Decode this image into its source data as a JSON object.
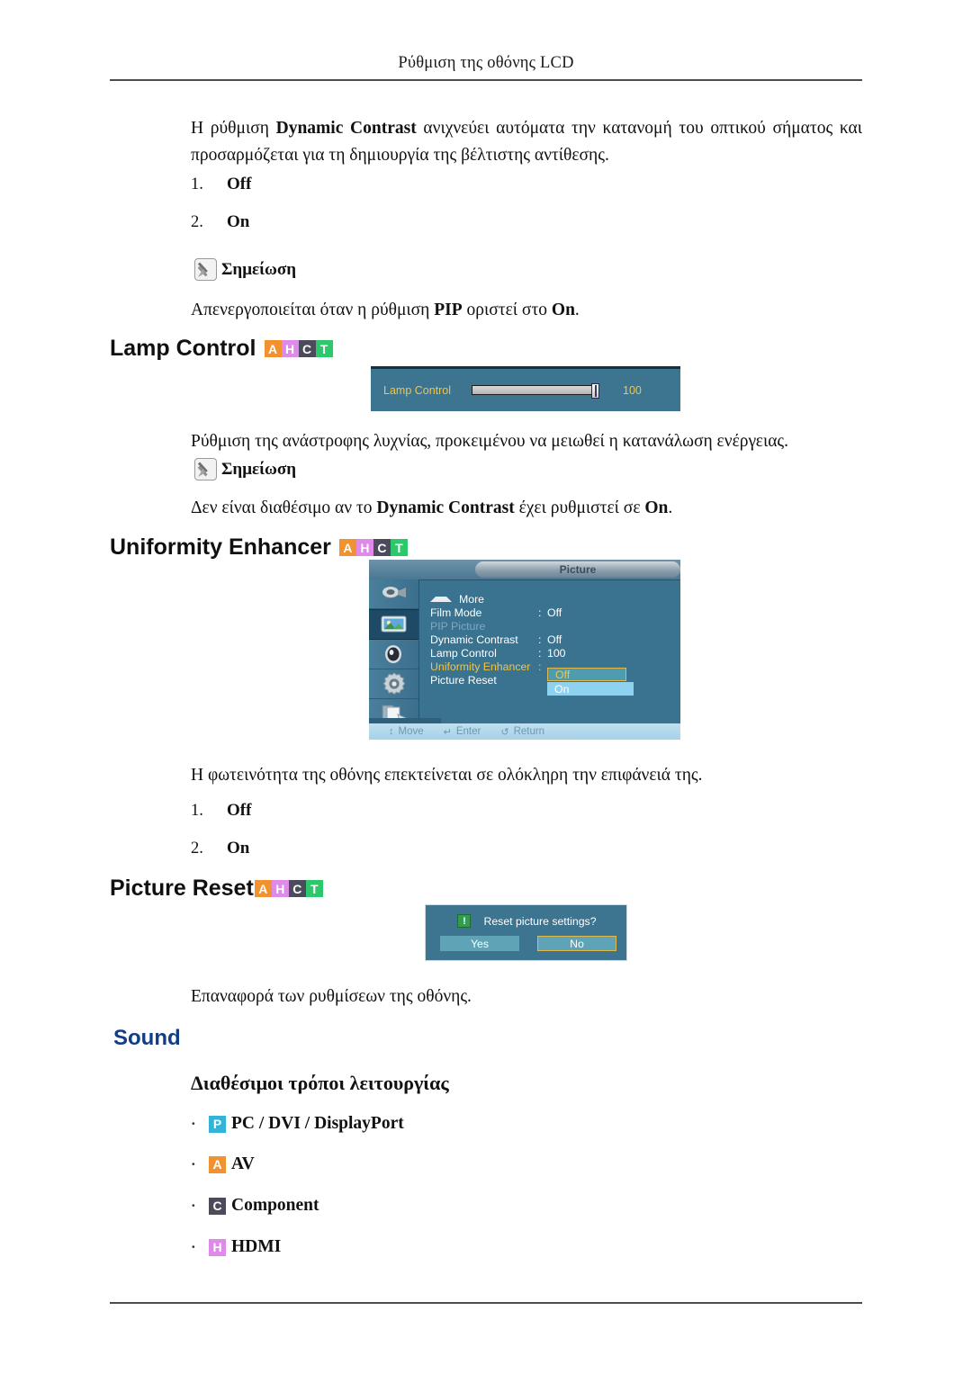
{
  "header": {
    "running_title": "Ρύθμιση της οθόνης LCD"
  },
  "intro": {
    "text_before": "Η ρύθμιση ",
    "bold": "Dynamic Contrast",
    "text_after": " ανιχνεύει αυτόματα την κατανομή του οπτικού σήματος και προσαρμόζεται για τη δημιουργία της βέλτιστης αντίθεσης."
  },
  "options_dc": [
    {
      "num": "1.",
      "value": "Off"
    },
    {
      "num": "2.",
      "value": "On"
    }
  ],
  "note1": {
    "label": "Σημείωση",
    "text_a": "Απενεργοποιείται όταν η ρύθμιση ",
    "bold_a": "PIP",
    "text_b": " οριστεί στο ",
    "bold_b": "On",
    "text_c": "."
  },
  "lamp_control": {
    "heading": "Lamp Control",
    "badges": [
      "A",
      "H",
      "C",
      "T"
    ],
    "osd": {
      "label": "Lamp Control",
      "value": "100",
      "fill_percent": 100
    },
    "description": "Ρύθμιση της ανάστροφης λυχνίας, προκειμένου να μειωθεί η κατανάλωση ενέργειας."
  },
  "note2": {
    "label": "Σημείωση",
    "text_a": "Δεν είναι διαθέσιμο αν το ",
    "bold_a": "Dynamic Contrast",
    "text_b": " έχει ρυθμιστεί σε ",
    "bold_b": "On",
    "text_c": "."
  },
  "uniformity_enhancer": {
    "heading": "Uniformity Enhancer",
    "badges": [
      "A",
      "H",
      "C",
      "T"
    ],
    "description": "Η φωτεινότητα της οθόνης επεκτείνεται σε ολόκληρη την επιφάνειά της.",
    "options": [
      {
        "num": "1.",
        "value": "Off"
      },
      {
        "num": "2.",
        "value": "On"
      }
    ]
  },
  "osd_menu": {
    "title": "Picture",
    "sidebar_icons": [
      "input-icon",
      "picture-icon",
      "sound-icon",
      "setup-icon",
      "multi-control-icon"
    ],
    "selected_sidebar_index": 1,
    "more_label": "More",
    "rows": [
      {
        "key": "Film Mode",
        "sep": ":",
        "value": "Off",
        "state": "normal"
      },
      {
        "key": "PIP Picture",
        "sep": "",
        "value": "",
        "state": "dim"
      },
      {
        "key": "Dynamic Contrast",
        "sep": ":",
        "value": "Off",
        "state": "normal"
      },
      {
        "key": "Lamp Control",
        "sep": ":",
        "value": "100",
        "state": "normal"
      },
      {
        "key": "Uniformity Enhancer",
        "sep": ":",
        "value": "",
        "state": "highlight"
      },
      {
        "key": "Picture Reset",
        "sep": "",
        "value": "",
        "state": "normal"
      }
    ],
    "dropdown": {
      "selected": "Off",
      "other": "On"
    },
    "footer": [
      {
        "icon": "move-icon",
        "glyph": "↕",
        "label": "Move"
      },
      {
        "icon": "enter-icon",
        "glyph": "↵",
        "label": "Enter"
      },
      {
        "icon": "return-icon",
        "glyph": "↺",
        "label": "Return"
      }
    ]
  },
  "picture_reset": {
    "heading": "Picture Reset",
    "badges": [
      "A",
      "H",
      "C",
      "T"
    ],
    "dialog": {
      "warning_icon": "warning-icon",
      "glyph": "!",
      "question": "Reset picture settings?",
      "yes_label": "Yes",
      "no_label": "No",
      "selected_button": "No"
    },
    "description": "Επαναφορά των ρυθμίσεων της οθόνης."
  },
  "sound": {
    "heading": "Sound",
    "subheading": "Διαθέσιμοι τρόποι λειτουργίας",
    "modes": [
      {
        "badge": "P",
        "badge_class": "b-P",
        "label": "PC / DVI / DisplayPort"
      },
      {
        "badge": "A",
        "badge_class": "b-A",
        "label": "AV"
      },
      {
        "badge": "C",
        "badge_class": "b-C",
        "label": "Component"
      },
      {
        "badge": "H",
        "badge_class": "b-H",
        "label": "HDMI"
      }
    ]
  },
  "colors": {
    "badge_a": "#f2912f",
    "badge_h": "#dd8ae8",
    "badge_c": "#4b4b5c",
    "badge_t": "#2dc86c",
    "badge_p": "#34b3d9",
    "osd_bg": "#3d7490",
    "osd_accent": "#f3c544",
    "sound_heading": "#123d86"
  }
}
